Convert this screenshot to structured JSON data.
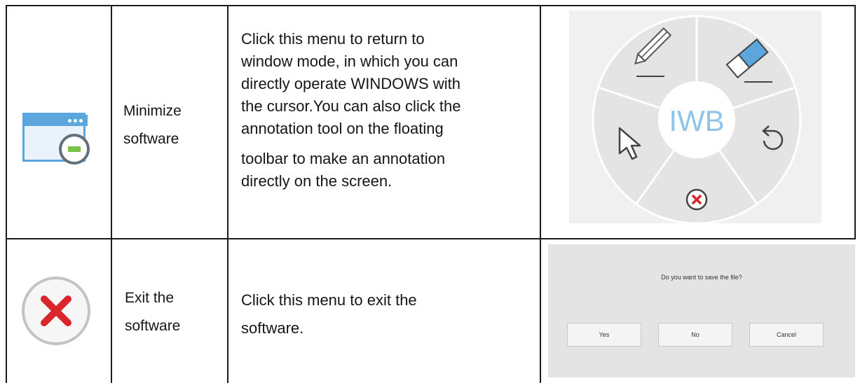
{
  "rows": [
    {
      "icon": "minimize-window-icon",
      "name_line1": "Minimize",
      "name_line2": "software",
      "description": [
        "Click this menu to return to",
        "window mode, in which you can",
        "directly operate WINDOWS with",
        "the cursor.You can also click the",
        "annotation tool on the floating",
        "toolbar to make an annotation",
        "directly on the screen."
      ],
      "image": {
        "type": "floating-toolbar",
        "center_label": "IWB",
        "tool_icons": [
          "pencil-icon",
          "eraser-icon",
          "cursor-arrow-icon",
          "undo-icon",
          "close-circle-icon"
        ]
      }
    },
    {
      "icon": "exit-x-icon",
      "name_line1": "Exit the",
      "name_line2": "software",
      "description": [
        "Click this menu to exit the",
        "software."
      ],
      "image": {
        "type": "save-dialog",
        "message": "Do you want to save the file?",
        "buttons": [
          "Yes",
          "No",
          "Cancel"
        ]
      }
    }
  ],
  "colors": {
    "accent_blue": "#5ba6dd",
    "minimize_green": "#7cc24a",
    "exit_red": "#d9252b",
    "border": "#1c1c1c"
  }
}
